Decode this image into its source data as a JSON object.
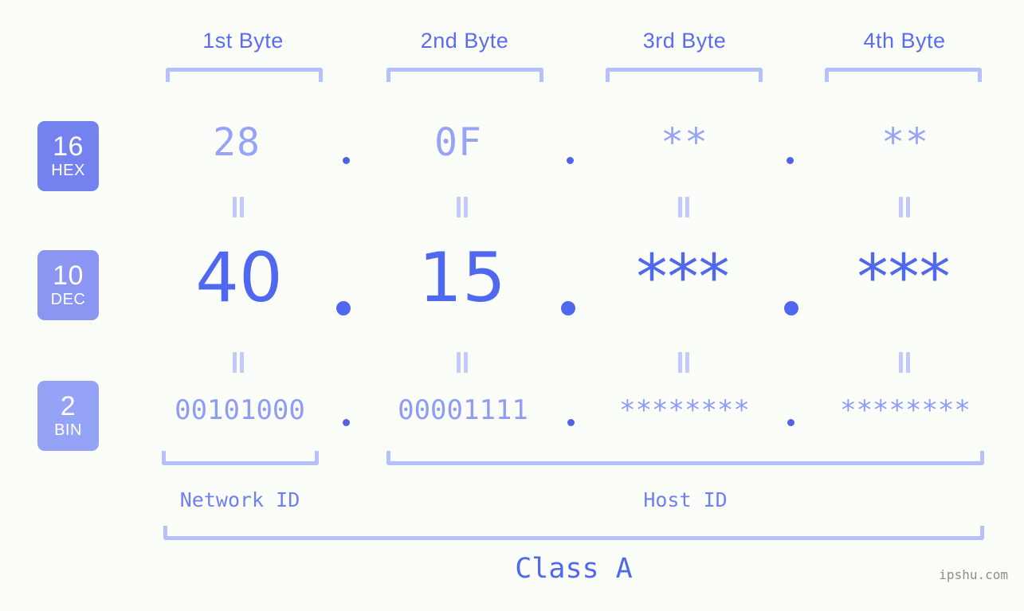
{
  "page": {
    "background_color": "#fbfdf8",
    "accent_color": "#5068ef",
    "accent_light_color": "#b6c0fb",
    "watermark": "ipshu.com"
  },
  "byte_headers": [
    {
      "label": "1st Byte"
    },
    {
      "label": "2nd Byte"
    },
    {
      "label": "3rd Byte"
    },
    {
      "label": "4th Byte"
    }
  ],
  "bases": [
    {
      "number": "16",
      "abbr": "HEX",
      "color": "#7382ee"
    },
    {
      "number": "10",
      "abbr": "DEC",
      "color": "#8a96f2"
    },
    {
      "number": "2",
      "abbr": "BIN",
      "color": "#94a3f6"
    }
  ],
  "rows": {
    "hex": {
      "values": [
        "28",
        "0F",
        "**",
        "**"
      ],
      "separators": [
        ".",
        ".",
        "."
      ]
    },
    "dec": {
      "values": [
        "40",
        "15",
        "***",
        "***"
      ],
      "separators": [
        ".",
        ".",
        "."
      ]
    },
    "bin": {
      "values": [
        "00101000",
        "00001111",
        "********",
        "********"
      ],
      "separators": [
        ".",
        ".",
        "."
      ]
    }
  },
  "equals_connectors": {
    "glyph": "="
  },
  "footer": {
    "network_id_label": "Network ID",
    "host_id_label": "Host ID",
    "class_label": "Class A"
  }
}
